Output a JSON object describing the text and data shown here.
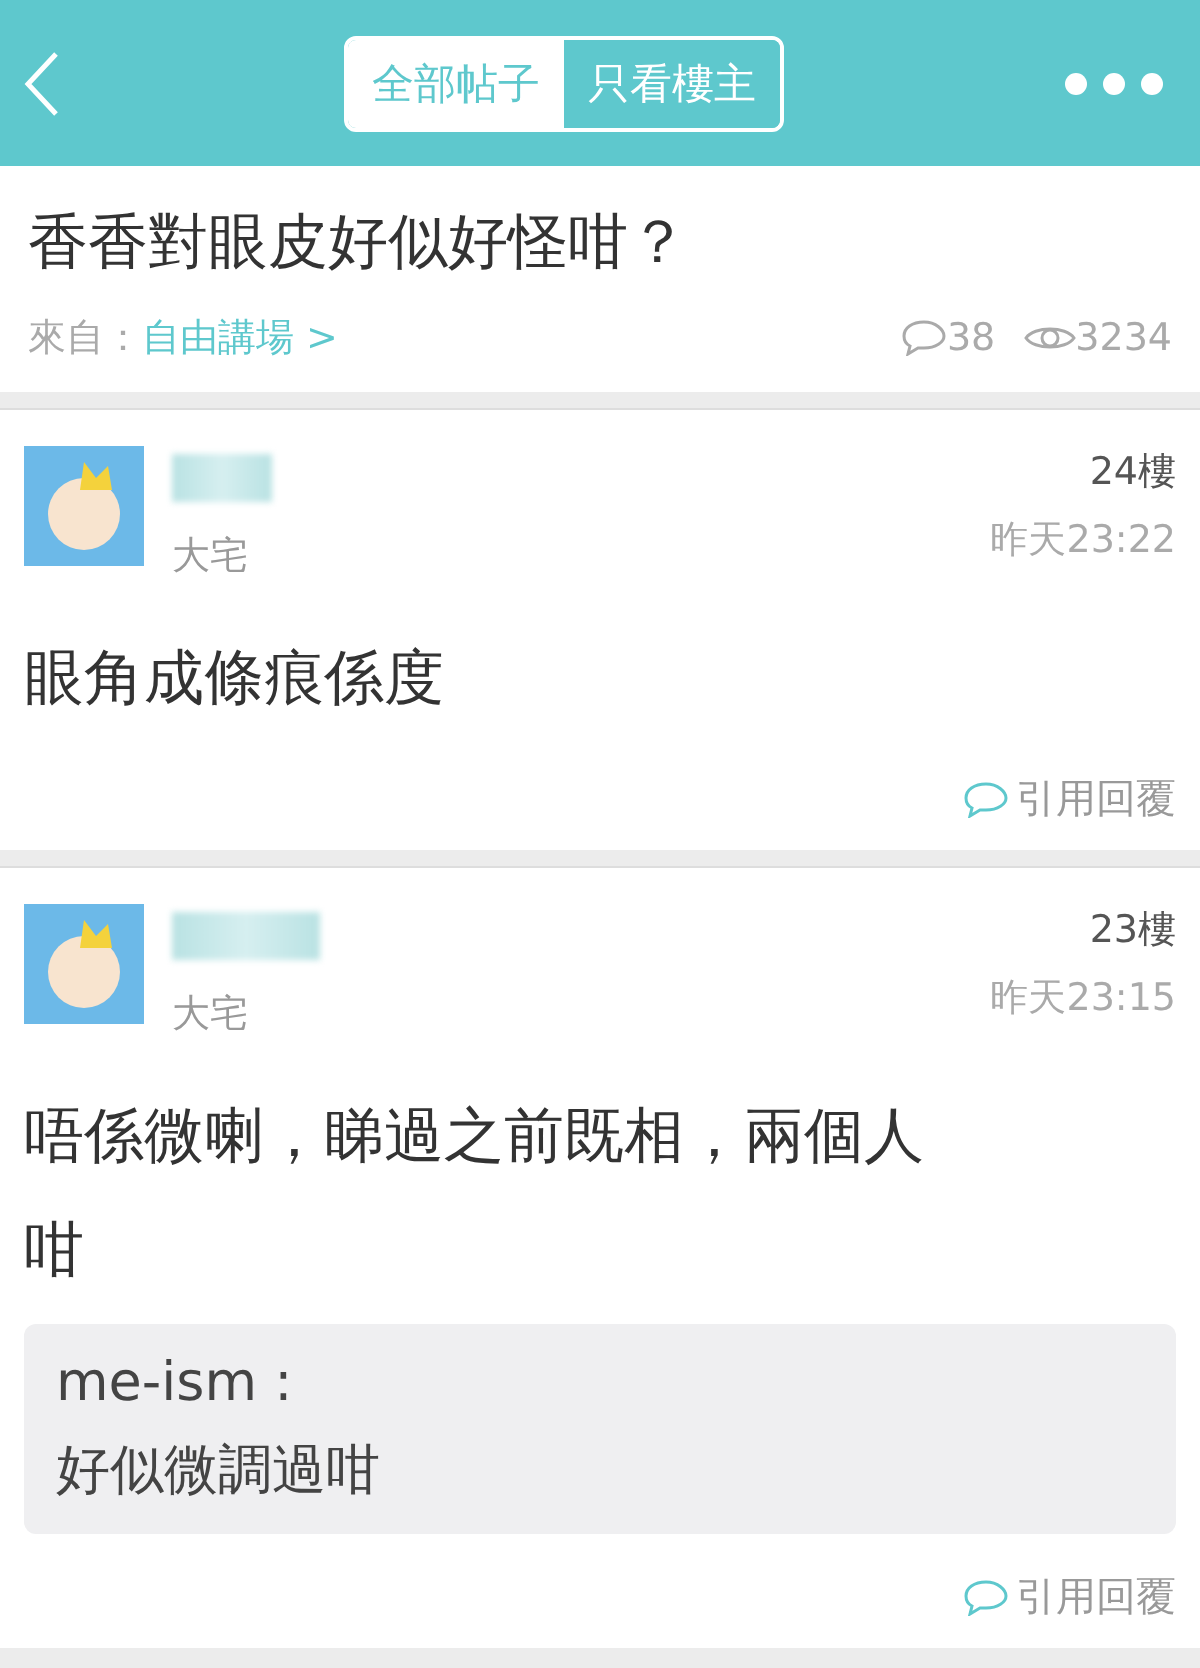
{
  "header": {
    "tabs": [
      {
        "label": "全部帖子",
        "selected": false
      },
      {
        "label": "只看樓主",
        "selected": true
      }
    ]
  },
  "thread": {
    "title": "香香對眼皮好似好怪咁？",
    "source_label": "來自：",
    "source_link": "自由講場 >",
    "comments": "38",
    "views": "3234"
  },
  "posts": [
    {
      "rank": "大宅",
      "floor": "24樓",
      "time": "昨天23:22",
      "body": [
        "眼角成條痕係度"
      ],
      "reply": "引用回覆"
    },
    {
      "rank": "大宅",
      "floor": "23樓",
      "time": "昨天23:15",
      "body": [
        "唔係微喇，睇過之前既相，兩個人",
        "咁"
      ],
      "quote": {
        "author": "me-ism :",
        "text": "好似微調過咁"
      },
      "reply": "引用回覆"
    }
  ]
}
